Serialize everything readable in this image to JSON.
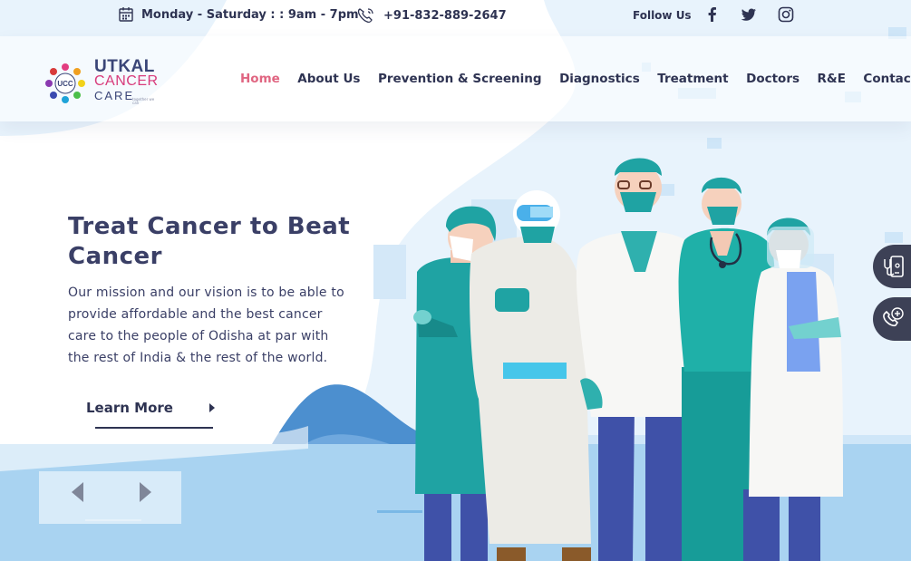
{
  "topbar": {
    "hours": "Monday - Saturday : : 9am - 7pm",
    "phone": "+91-832-889-2647",
    "follow": "Follow Us",
    "socials": [
      "facebook-icon",
      "twitter-icon",
      "instagram-icon"
    ]
  },
  "logo": {
    "line1": "UTKAL",
    "line2": "CANCER",
    "line3": "CARE",
    "badge": "UCC",
    "tagline": "together we can"
  },
  "nav": {
    "items": [
      "Home",
      "About Us",
      "Prevention & Screening",
      "Diagnostics",
      "Treatment",
      "Doctors",
      "R&E",
      "Contact Us"
    ],
    "active": "Home"
  },
  "hero": {
    "title": "Treat Cancer to Beat Cancer",
    "text": "Our mission and our vision is to be able to provide affordable and the best cancer care to the people of Odisha at par with the rest of India & the rest of the world.",
    "cta": "Learn More"
  },
  "side_buttons": [
    "mobile-stethoscope-icon",
    "phone-plus-icon"
  ],
  "colors": {
    "accent": "#e06581",
    "navy": "#2e3352",
    "teal": "#1fa3a3",
    "sky": "#a9d3f1"
  }
}
